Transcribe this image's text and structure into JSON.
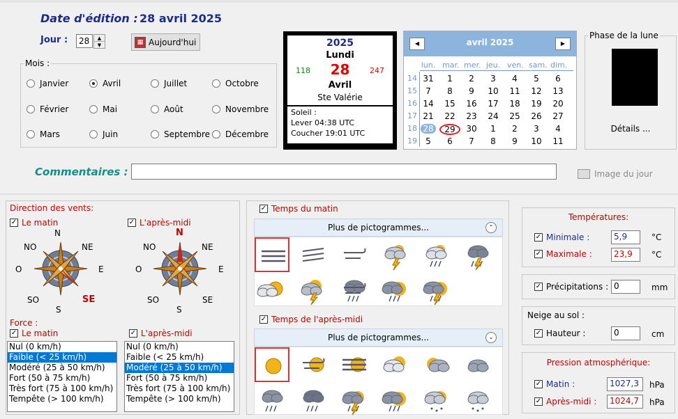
{
  "header": {
    "edition_label": "Date d'édition :",
    "edition_date": "28 avril 2025"
  },
  "day": {
    "label": "Jour :",
    "value": "28",
    "today_button": "Aujourd'hui"
  },
  "months": {
    "legend": "Mois :",
    "items": [
      "Janvier",
      "Février",
      "Mars",
      "Avril",
      "Mai",
      "Juin",
      "Juillet",
      "Août",
      "Septembre",
      "Octobre",
      "Novembre",
      "Décembre"
    ],
    "selected": "Avril"
  },
  "sun": {
    "year": "2025",
    "day_name": "Lundi",
    "day_number": "28",
    "day_of_year": "118",
    "days_remaining": "247",
    "month": "Avril",
    "saint": "Ste Valérie",
    "info_title": "Soleil :",
    "sunrise": "Lever 04:38 UTC",
    "sunset": "Coucher 19:01 UTC"
  },
  "calendar": {
    "title": "avril 2025",
    "weekdays": [
      "lun.",
      "mar.",
      "mer.",
      "jeu.",
      "ven.",
      "sam.",
      "dim."
    ],
    "weeks": [
      {
        "num": "14",
        "days": [
          "31",
          "1",
          "2",
          "3",
          "4",
          "5",
          "6"
        ]
      },
      {
        "num": "15",
        "days": [
          "7",
          "8",
          "9",
          "10",
          "11",
          "12",
          "13"
        ]
      },
      {
        "num": "16",
        "days": [
          "14",
          "15",
          "16",
          "17",
          "18",
          "19",
          "20"
        ]
      },
      {
        "num": "17",
        "days": [
          "21",
          "22",
          "23",
          "24",
          "25",
          "26",
          "27"
        ]
      },
      {
        "num": "18",
        "days": [
          "28",
          "29",
          "30",
          "1",
          "2",
          "3",
          "4"
        ]
      },
      {
        "num": "19",
        "days": [
          "5",
          "6",
          "7",
          "8",
          "9",
          "10",
          "11"
        ]
      }
    ],
    "selected_day": "28",
    "today_circle": "29",
    "accent": "#8cb4dc"
  },
  "moon": {
    "legend": "Phase de la lune",
    "details": "Détails ..."
  },
  "comments": {
    "label": "Commentaires :",
    "value": "",
    "image_label": "Image du jour"
  },
  "wind": {
    "title": "Direction des vents:",
    "morning_label": "Le matin",
    "afternoon_label": "L'après-midi",
    "points": {
      "n": "N",
      "ne": "NE",
      "e": "E",
      "se": "SE",
      "s": "S",
      "so": "SO",
      "o": "O",
      "no": "NO"
    },
    "morning_dir": "SE",
    "afternoon_dir": "N"
  },
  "force": {
    "title": "Force :",
    "morning_label": "Le matin",
    "afternoon_label": "L'après-midi",
    "options": [
      "Nul (0 km/h)",
      "Faible (< 25 km/h)",
      "Modéré (25 à 50 km/h)",
      "Fort (50 à 75 km/h)",
      "Très fort (75 à 100 km/h)",
      "Tempête (> 100 km/h)"
    ],
    "morning_selected": 1,
    "afternoon_selected": 2
  },
  "weather": {
    "morning_label": "Temps du matin",
    "afternoon_label": "Temps de l'après-midi",
    "more_label": "Plus de pictogrammes...",
    "morning_icons": [
      "fog-icon",
      "haze-icon",
      "wind-icon",
      "partly-cloudy-thunder-icon",
      "cloudy-sun-rain-icon",
      "thunderstorm-icon",
      "sun-behind-cloud-icon",
      "sun-thunder-icon",
      "rain-wind-icon",
      "cloud-rain-sun-icon",
      "rain-sun-thunder-icon"
    ],
    "afternoon_icons": [
      "sun-icon",
      "sun-wind-icon",
      "sun-haze-icon",
      "sun-cloud-icon",
      "cloud-sun-icon",
      "cloud-icon",
      "rain-icon",
      "heavy-rain-icon",
      "storm-sun-icon",
      "rain-sun-icon",
      "snow-sun-icon",
      "snow-icon"
    ]
  },
  "temperatures": {
    "title": "Températures:",
    "min_label": "Minimale :",
    "min_value": "5,9",
    "max_label": "Maximale :",
    "max_value": "23,9",
    "unit": "°C"
  },
  "precip": {
    "label": "Précipitations :",
    "value": "0",
    "unit": "mm"
  },
  "snow": {
    "title": "Neige au sol :",
    "label": "Hauteur :",
    "value": "0",
    "unit": "cm"
  },
  "pressure": {
    "title": "Pression atmosphérique:",
    "morning_label": "Matin :",
    "morning_value": "1027,3",
    "afternoon_label": "Après-midi :",
    "afternoon_value": "1024,7",
    "unit": "hPa"
  }
}
